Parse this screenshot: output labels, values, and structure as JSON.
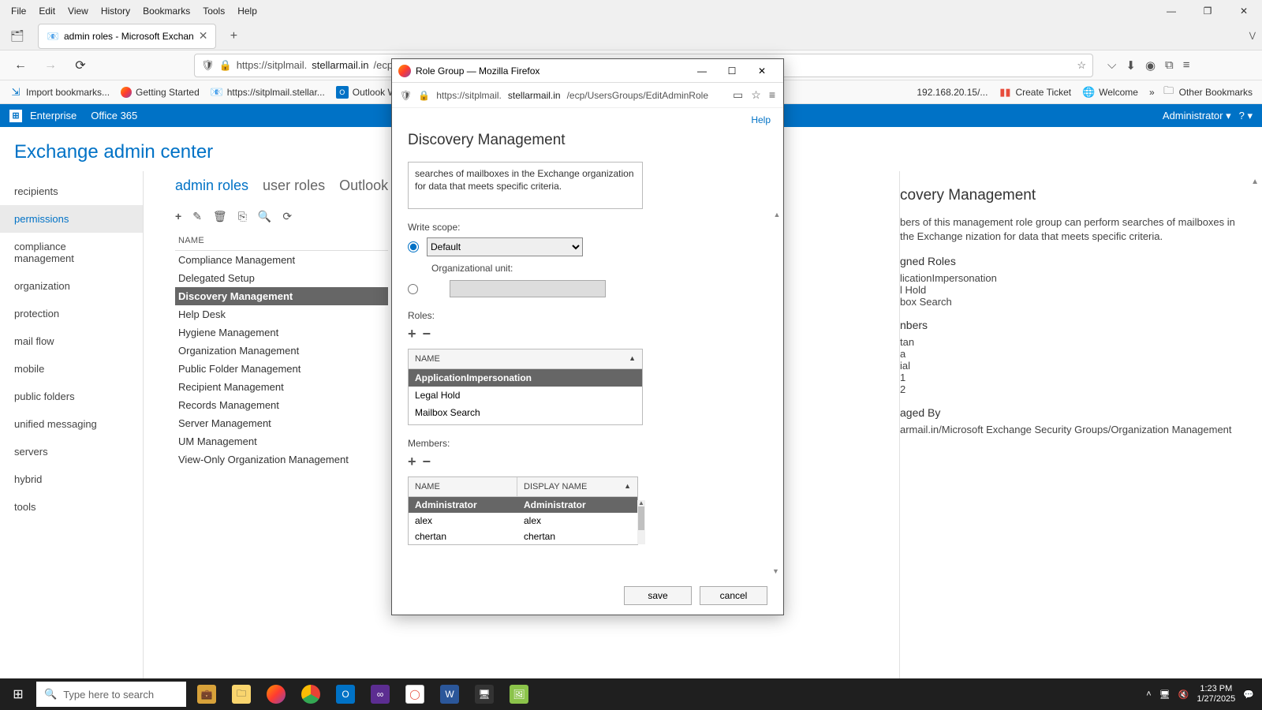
{
  "menubar": [
    "File",
    "Edit",
    "View",
    "History",
    "Bookmarks",
    "Tools",
    "Help"
  ],
  "browser_tab": {
    "title": "admin roles - Microsoft Exchan"
  },
  "urlbar": {
    "prefix": "https://sitplmail.",
    "domain": "stellarmail.in",
    "suffix": "/ecp/"
  },
  "bookmarks": {
    "import": "Import bookmarks...",
    "getting_started": "Getting Started",
    "sitpl": "https://sitplmail.stellar...",
    "owa": "Outlook Web App",
    "ip": "192.168.20.15/...",
    "create_ticket": "Create Ticket",
    "welcome": "Welcome",
    "other": "Other Bookmarks"
  },
  "banner": {
    "enterprise": "Enterprise",
    "o365": "Office 365",
    "admin": "Administrator"
  },
  "eac": {
    "title": "Exchange admin center",
    "sidebar": [
      "recipients",
      "permissions",
      "compliance management",
      "organization",
      "protection",
      "mail flow",
      "mobile",
      "public folders",
      "unified messaging",
      "servers",
      "hybrid",
      "tools"
    ],
    "sidebar_active": 1,
    "tabs": [
      "admin roles",
      "user roles",
      "Outlook Web"
    ],
    "tabs_active": 0,
    "table_header": "NAME",
    "roles": [
      "Compliance Management",
      "Delegated Setup",
      "Discovery Management",
      "Help Desk",
      "Hygiene Management",
      "Organization Management",
      "Public Folder Management",
      "Recipient Management",
      "Records Management",
      "Server Management",
      "UM Management",
      "View-Only Organization Management"
    ],
    "roles_selected": 2,
    "detail": {
      "title": "covery Management",
      "desc": "bers of this management role group can perform searches of mailboxes in the Exchange nization for data that meets specific criteria.",
      "assigned_roles_h": "gned Roles",
      "assigned_roles": [
        "licationImpersonation",
        "l Hold",
        "box Search"
      ],
      "members_h": "nbers",
      "members": [
        "tan",
        "a",
        "ial",
        "1",
        "2"
      ],
      "managed_h": "aged By",
      "managed": "armail.in/Microsoft Exchange Security Groups/Organization Management"
    }
  },
  "popup": {
    "title": "Role Group — Mozilla Firefox",
    "url_prefix": "https://sitplmail.",
    "url_domain": "stellarmail.in",
    "url_suffix": "/ecp/UsersGroups/EditAdminRole",
    "help": "Help",
    "h1": "Discovery Management",
    "desc": "searches of mailboxes in the Exchange organization for data that meets specific criteria.",
    "write_scope_label": "Write scope:",
    "scope_default": "Default",
    "ou_label": "Organizational unit:",
    "roles_label": "Roles:",
    "roles_header": "NAME",
    "roles_list": [
      "ApplicationImpersonation",
      "Legal Hold",
      "Mailbox Search"
    ],
    "roles_selected": 0,
    "members_label": "Members:",
    "members_header_name": "NAME",
    "members_header_display": "DISPLAY NAME",
    "members_rows": [
      {
        "name": "Administrator",
        "display": "Administrator"
      },
      {
        "name": "alex",
        "display": "alex"
      },
      {
        "name": "chertan",
        "display": "chertan"
      }
    ],
    "members_selected": 0,
    "save": "save",
    "cancel": "cancel"
  },
  "taskbar": {
    "search_placeholder": "Type here to search",
    "time": "1:23 PM",
    "date": "1/27/2025"
  }
}
